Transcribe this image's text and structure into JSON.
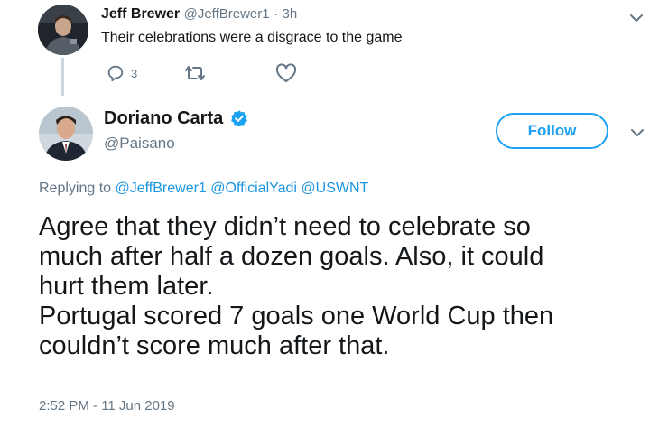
{
  "parent_tweet": {
    "name": "Jeff Brewer",
    "handle": "@JeffBrewer1",
    "separator": "·",
    "time": "3h",
    "text": "Their celebrations were a disgrace to the game",
    "reply_count": "3",
    "icons": [
      "avatar",
      "reply-icon",
      "retweet-icon",
      "like-icon",
      "chevron-down-icon"
    ]
  },
  "reply_tweet": {
    "name": "Doriano Carta",
    "handle": "@Paisano",
    "verified": true,
    "follow_label": "Follow",
    "replying_prefix": "Replying to",
    "replying_to": [
      "@JeffBrewer1",
      "@OfficialYadi",
      "@USWNT"
    ],
    "body_lines": [
      "Agree that they didn’t need to celebrate so",
      "much after half a dozen goals. Also, it could",
      "hurt them later.",
      "Portugal scored 7 goals one World Cup then",
      "couldn’t score much after that."
    ],
    "timestamp": "2:52 PM - 11 Jun 2019",
    "icons": [
      "avatar",
      "verified-badge-icon",
      "chevron-down-icon"
    ]
  },
  "colors": {
    "accent": "#1da1f2",
    "link": "#1b95e0",
    "text": "#14171a",
    "muted": "#657786",
    "thread_line": "#cfd6dc"
  }
}
